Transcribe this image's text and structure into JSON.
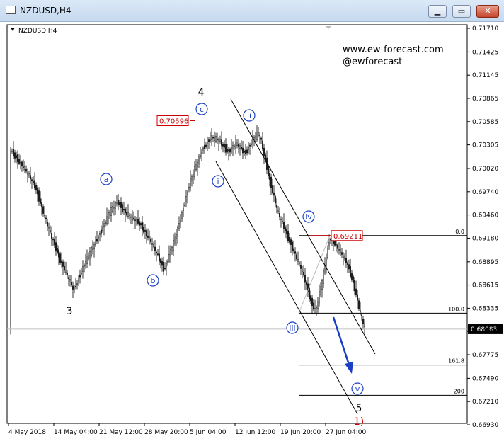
{
  "window": {
    "title": "NZDUSD,H4",
    "minimize_glyph": "▁",
    "maximize_glyph": "▭",
    "close_glyph": "✕"
  },
  "watermark": {
    "site": "www.ew-forecast.com",
    "handle": "@ewforecast"
  },
  "chart_data": {
    "type": "candlestick",
    "symbol_label": "NZDUSD,H4",
    "y_axis_ticks": [
      "0.71710",
      "0.71425",
      "0.71145",
      "0.70865",
      "0.70585",
      "0.70305",
      "0.70020",
      "0.69740",
      "0.69460",
      "0.69180",
      "0.68895",
      "0.68615",
      "0.68335",
      "0.68055",
      "0.67775",
      "0.67490",
      "0.67210",
      "0.66930"
    ],
    "x_axis_ticks": [
      "4 May 2018",
      "14 May 04:00",
      "21 May 12:00",
      "28 May 20:00",
      "5 Jun 04:00",
      "12 Jun 12:00",
      "19 Jun 20:00",
      "27 Jun 04:00"
    ],
    "ylim": [
      0.6693,
      0.7171
    ],
    "current_price": "0.68083",
    "price_labels": [
      {
        "text": "0.70596",
        "value": 0.70596
      },
      {
        "text": "0.69211",
        "value": 0.69211
      }
    ],
    "fibonacci_levels": [
      {
        "label": "0.0",
        "value": 0.69211
      },
      {
        "label": "100.0",
        "value": 0.68275
      },
      {
        "label": "161.8",
        "value": 0.6765
      },
      {
        "label": "200",
        "value": 0.67285
      }
    ],
    "wave_labels": [
      {
        "text": "3",
        "style": "plain"
      },
      {
        "text": "4",
        "style": "plain"
      },
      {
        "text": "5",
        "style": "plain"
      },
      {
        "text": "1)",
        "style": "red"
      },
      {
        "text": "a",
        "style": "circled"
      },
      {
        "text": "b",
        "style": "circled"
      },
      {
        "text": "c",
        "style": "circled"
      },
      {
        "text": "i",
        "style": "circled"
      },
      {
        "text": "ii",
        "style": "circled"
      },
      {
        "text": "iii",
        "style": "circled"
      },
      {
        "text": "iv",
        "style": "circled"
      },
      {
        "text": "v",
        "style": "circled"
      }
    ],
    "price_path": [
      [
        0,
        0.7025
      ],
      [
        9,
        0.7005
      ],
      [
        18,
        0.698
      ],
      [
        27,
        0.693
      ],
      [
        36,
        0.689
      ],
      [
        45,
        0.6855
      ],
      [
        52,
        0.6885
      ],
      [
        61,
        0.6915
      ],
      [
        70,
        0.6948
      ],
      [
        76,
        0.6962
      ],
      [
        82,
        0.6948
      ],
      [
        92,
        0.6935
      ],
      [
        100,
        0.6912
      ],
      [
        109,
        0.688
      ],
      [
        118,
        0.6925
      ],
      [
        127,
        0.6985
      ],
      [
        136,
        0.7025
      ],
      [
        142,
        0.704
      ],
      [
        148,
        0.7035
      ],
      [
        154,
        0.7022
      ],
      [
        160,
        0.7032
      ],
      [
        166,
        0.702
      ],
      [
        172,
        0.7038
      ],
      [
        176,
        0.7045
      ],
      [
        183,
        0.6992
      ],
      [
        189,
        0.695
      ],
      [
        195,
        0.6925
      ],
      [
        201,
        0.69
      ],
      [
        207,
        0.6875
      ],
      [
        213,
        0.684
      ],
      [
        216,
        0.683
      ],
      [
        221,
        0.687
      ],
      [
        226,
        0.692
      ],
      [
        232,
        0.6905
      ],
      [
        238,
        0.6888
      ],
      [
        243,
        0.6862
      ],
      [
        247,
        0.683
      ],
      [
        250,
        0.6812
      ]
    ]
  }
}
